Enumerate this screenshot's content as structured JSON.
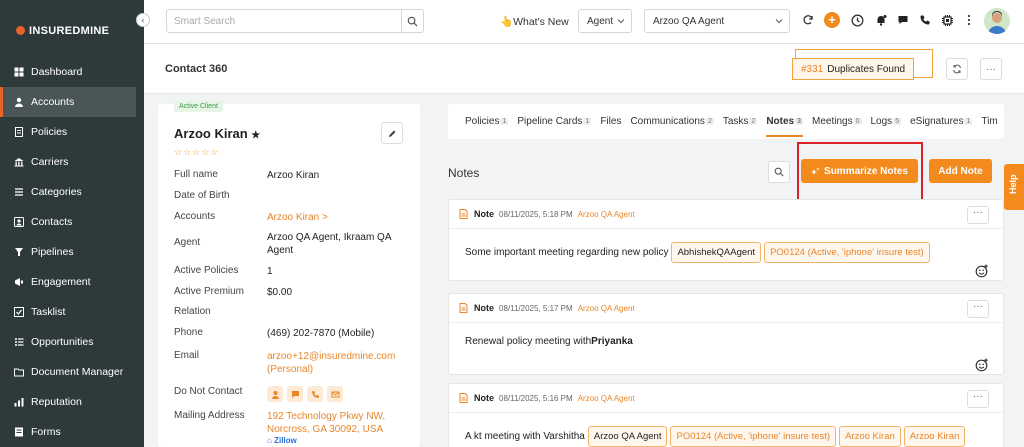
{
  "brand": {
    "name": "INSUREDMINE"
  },
  "sidebar": {
    "items": [
      {
        "label": "Dashboard",
        "icon": "dashboard-icon"
      },
      {
        "label": "Accounts",
        "icon": "accounts-icon",
        "active": true
      },
      {
        "label": "Policies",
        "icon": "policies-icon"
      },
      {
        "label": "Carriers",
        "icon": "carriers-icon"
      },
      {
        "label": "Categories",
        "icon": "categories-icon"
      },
      {
        "label": "Contacts",
        "icon": "contacts-icon"
      },
      {
        "label": "Pipelines",
        "icon": "pipelines-icon"
      },
      {
        "label": "Engagement",
        "icon": "engagement-icon"
      },
      {
        "label": "Tasklist",
        "icon": "tasklist-icon"
      },
      {
        "label": "Opportunities",
        "icon": "opportunities-icon"
      },
      {
        "label": "Document Manager",
        "icon": "document-manager-icon"
      },
      {
        "label": "Reputation",
        "icon": "reputation-icon"
      },
      {
        "label": "Forms",
        "icon": "forms-icon"
      }
    ]
  },
  "topbar": {
    "search_placeholder": "Smart Search",
    "whats_new": "What's New",
    "role_select": "Agent",
    "agent_select": "Arzoo QA Agent"
  },
  "header": {
    "title": "Contact 360",
    "duplicates_count": "#331",
    "duplicates_label": "Duplicates Found",
    "more": "···"
  },
  "contact": {
    "badge": "Active Client",
    "name": "Arzoo Kiran",
    "star": "★",
    "rating": "☆☆☆☆☆",
    "fields": {
      "full_name_label": "Full name",
      "full_name": "Arzoo Kiran",
      "dob_label": "Date of Birth",
      "accounts_label": "Accounts",
      "accounts": "Arzoo Kiran >",
      "agent_label": "Agent",
      "agent_line1": "Arzoo QA Agent, Ikraam QA",
      "agent_line2": "Agent",
      "active_policies_label": "Active Policies",
      "active_policies": "1",
      "active_premium_label": "Active Premium",
      "active_premium": "$0.00",
      "relation_label": "Relation",
      "phone_label": "Phone",
      "phone": "(469) 202-7870 (Mobile)",
      "email_label": "Email",
      "email_line1": "arzoo+12@insuredmine.com",
      "email_line2": "(Personal)",
      "dnc_label": "Do Not Contact",
      "mailing_label": "Mailing Address",
      "mailing_line1": "192 Technology Pkwy NW,",
      "mailing_line2": "Norcross, GA 30092, USA",
      "zillow": "Zillow"
    }
  },
  "tabs": [
    {
      "label": "Policies",
      "count": "1"
    },
    {
      "label": "Pipeline Cards",
      "count": "1"
    },
    {
      "label": "Files",
      "count": ""
    },
    {
      "label": "Communications",
      "count": "2"
    },
    {
      "label": "Tasks",
      "count": "2"
    },
    {
      "label": "Notes",
      "count": "3",
      "active": true
    },
    {
      "label": "Meetings",
      "count": "0"
    },
    {
      "label": "Logs",
      "count": "5"
    },
    {
      "label": "eSignatures",
      "count": "1"
    },
    {
      "label": "Tim",
      "count": ""
    }
  ],
  "notes_section": {
    "title": "Notes",
    "summarize_label": "Summarize Notes",
    "add_label": "Add Note"
  },
  "notes": [
    {
      "label": "Note",
      "datetime": "08/11/2025, 5:18 PM",
      "agent": "Arzoo QA Agent",
      "text": "Some important meeting regarding new policy",
      "tags": [
        {
          "text": "AbhishekQAAgent",
          "style": "plain"
        },
        {
          "text": "PO0124 (Active, 'iphone' insure test)",
          "style": "orange"
        }
      ]
    },
    {
      "label": "Note",
      "datetime": "08/11/2025, 5:17 PM",
      "agent": "Arzoo QA Agent",
      "text": "Renewal policy meeting with ",
      "bold": "Priyanka",
      "tags": []
    },
    {
      "label": "Note",
      "datetime": "08/11/2025, 5:16 PM",
      "agent": "Arzoo QA Agent",
      "text": "A kt meeting with Varshitha",
      "tags": [
        {
          "text": "Arzoo QA Agent",
          "style": "plain"
        },
        {
          "text": "PO0124 (Active, 'iphone' insure test)",
          "style": "orange"
        },
        {
          "text": "Arzoo Kiran",
          "style": "orange"
        },
        {
          "text": "Arzoo Kiran",
          "style": "orange"
        }
      ]
    }
  ],
  "help": {
    "label": "Help"
  },
  "colors": {
    "accent": "#f28a1e",
    "sidebar": "#2e3a3a",
    "highlight": "#d9222a"
  }
}
